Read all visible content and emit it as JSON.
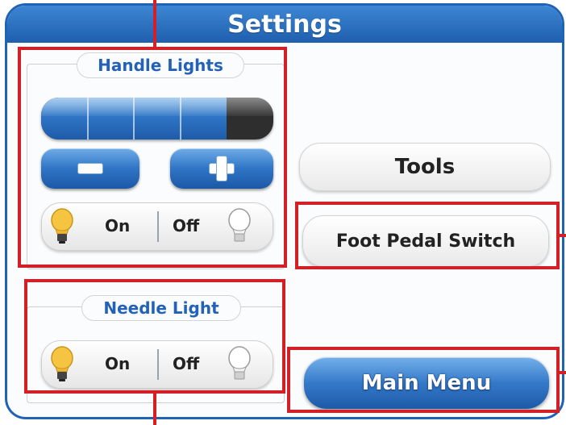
{
  "header": {
    "title": "Settings"
  },
  "handle_lights": {
    "label": "Handle Lights",
    "level_fraction": 0.8,
    "level_segments": 5,
    "decrease_symbol": "−",
    "increase_symbol": "+",
    "on_label": "On",
    "off_label": "Off"
  },
  "needle_light": {
    "label": "Needle Light",
    "on_label": "On",
    "off_label": "Off"
  },
  "buttons": {
    "tools": "Tools",
    "foot_pedal_switch": "Foot Pedal Switch",
    "main_menu": "Main Menu"
  },
  "colors": {
    "accent_blue": "#2362b6",
    "annotation_red": "#d31f26",
    "bulb_on": "#f5c542"
  },
  "icons": {
    "bulb_on": "lightbulb-on-icon",
    "bulb_off": "lightbulb-off-icon",
    "minus": "minus-icon",
    "plus": "plus-icon"
  }
}
